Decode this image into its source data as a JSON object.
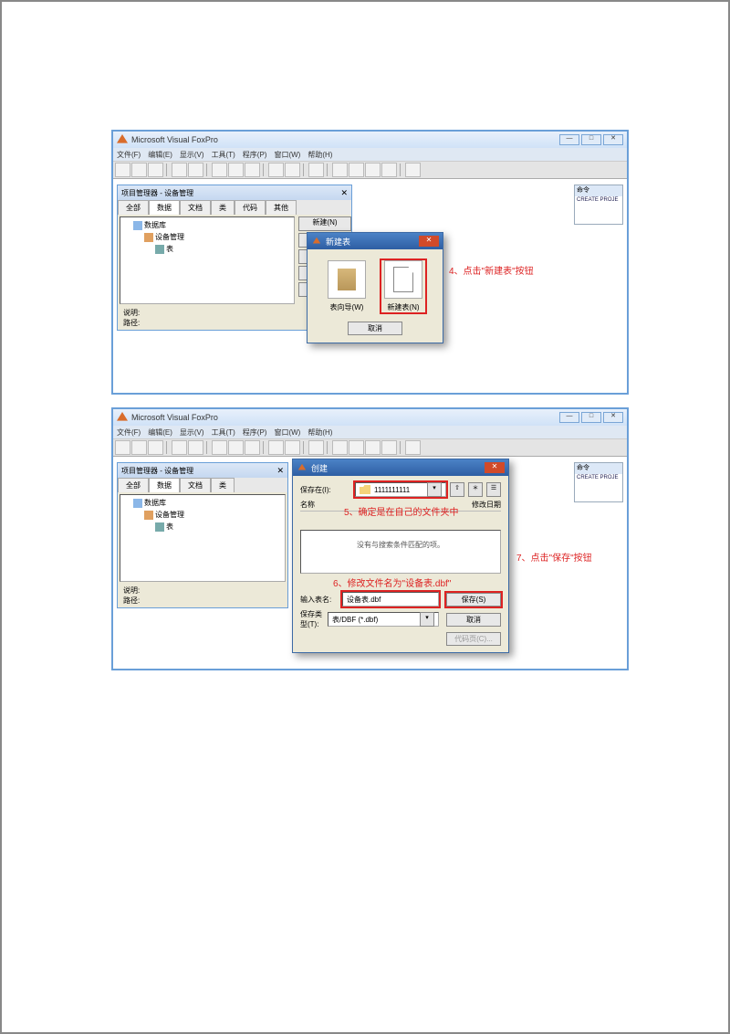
{
  "app": {
    "title": "Microsoft Visual FoxPro",
    "menu": [
      "文件(F)",
      "编辑(E)",
      "显示(V)",
      "工具(T)",
      "程序(P)",
      "窗口(W)",
      "帮助(H)"
    ]
  },
  "project_manager": {
    "title": "项目管理器 - 设备管理",
    "tabs": [
      "全部",
      "数据",
      "文档",
      "类",
      "代码",
      "其他"
    ],
    "tree": {
      "root": "数据库",
      "child1": "设备管理",
      "child2": "表"
    },
    "buttons": [
      "新建(N)"
    ],
    "footer_desc": "说明:",
    "footer_path": "路径:"
  },
  "cmd": {
    "title": "命令",
    "line": "CREATE PROJE"
  },
  "dialog_newtable": {
    "title": "新建表",
    "wizard_label": "表向导(W)",
    "new_label": "新建表(N)",
    "cancel": "取消"
  },
  "dialog_save": {
    "title": "创建",
    "save_in_label": "保存在(I):",
    "save_in_value": "1111111111",
    "name_header": "名称",
    "date_header": "修改日期",
    "empty_msg": "没有与搜索条件匹配的项。",
    "input_label": "输入表名:",
    "input_value": "设备表.dbf",
    "type_label": "保存类型(T):",
    "type_value": "表/DBF (*.dbf)",
    "save_btn": "保存(S)",
    "cancel_btn": "取消",
    "codepage_btn": "代码页(C)..."
  },
  "annotations": {
    "a4": "4、点击\"新建表\"按钮",
    "a5": "5、确定是在自己的文件夹中",
    "a6": "6、修改文件名为\"设备表.dbf\"",
    "a7": "7、点击\"保存\"按钮"
  }
}
